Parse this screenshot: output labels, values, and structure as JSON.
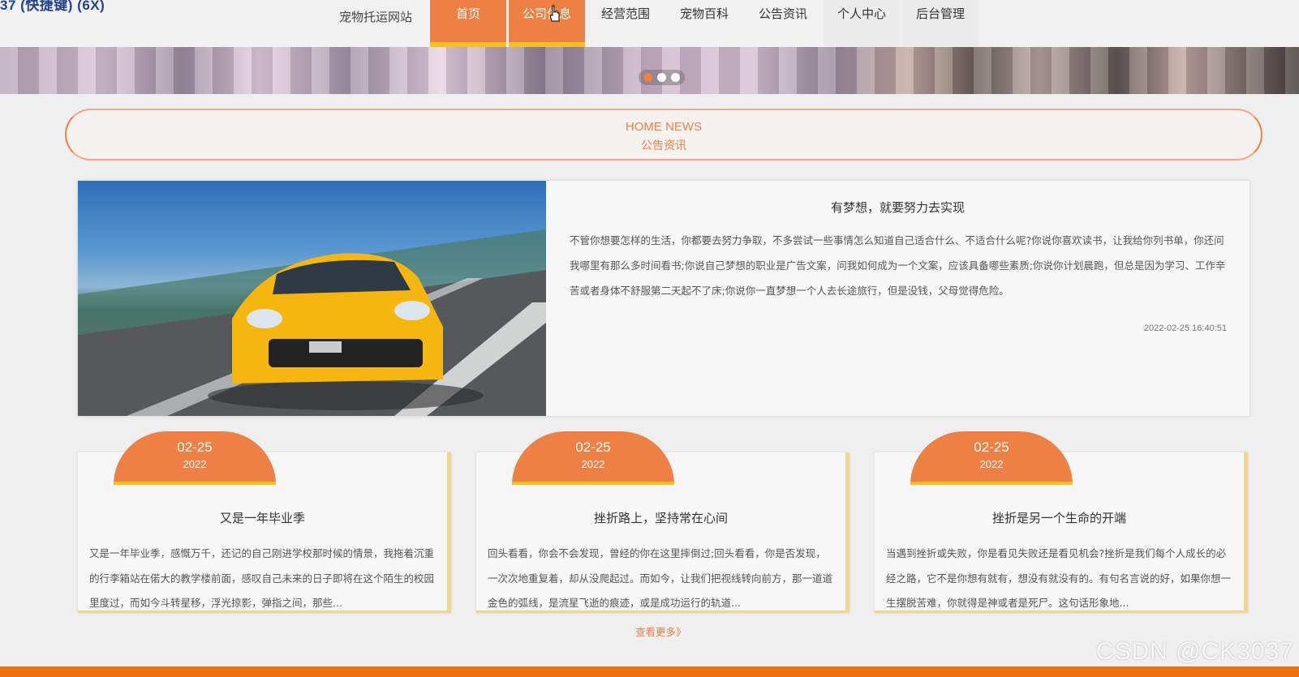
{
  "overlay": {
    "caption": "37 (快捷键) (6X)"
  },
  "header": {
    "site_name": "宠物托运网站",
    "nav": [
      "首页",
      "公司信息",
      "经营范围",
      "宠物百科",
      "公告资讯",
      "个人中心",
      "后台管理"
    ],
    "active_index": 0
  },
  "carousel": {
    "dot_count": 3,
    "active_dot": 0
  },
  "section": {
    "title_en": "HOME NEWS",
    "title_cn": "公告资讯"
  },
  "featured": {
    "title": "有梦想，就要努力去实现",
    "text": "不管你想要怎样的生活，你都要去努力争取，不多尝试一些事情怎么知道自己适合什么、不适合什么呢?你说你喜欢读书，让我给你列书单，你还问我哪里有那么多时间看书;你说自己梦想的职业是广告文案，问我如何成为一个文案，应该具备哪些素质;你说你计划晨跑，但总是因为学习、工作辛苦或者身体不舒服第二天起不了床;你说你一直梦想一个人去长途旅行，但是没钱，父母觉得危险。",
    "time": "2022-02-25 16:40:51"
  },
  "cards": [
    {
      "md": "02-25",
      "year": "2022",
      "title": "又是一年毕业季",
      "text": "又是一年毕业季，感慨万千，还记的自己刚进学校那时候的情景，我拖着沉重的行李箱站在偌大的教学楼前面，感叹自己未来的日子即将在这个陌生的校园里度过，而如今斗转星移，浮光掠影，弹指之间，那些..."
    },
    {
      "md": "02-25",
      "year": "2022",
      "title": "挫折路上，坚持常在心间",
      "text": "回头看看，你会不会发现，曾经的你在这里摔倒过;回头看看，你是否发现，一次次地重复着，却从没爬起过。而如今，让我们把视线转向前方，那一道道金色的弧线，是流星飞逝的痕迹，或是成功运行的轨道..."
    },
    {
      "md": "02-25",
      "year": "2022",
      "title": "挫折是另一个生命的开端",
      "text": "当遇到挫折或失败，你是看见失败还是看见机会?挫折是我们每个人成长的必经之路，它不是你想有就有，想没有就没有的。有句名言说的好，如果你想一生摆脱苦难，你就得是神或者是死尸。这句话形象地..."
    }
  ],
  "more_label": "查看更多》",
  "watermark": "CSDN @CK3037",
  "colors": {
    "accent": "#ee7f45",
    "accent_bottom": "#f6c022",
    "footer": "#ee6e10"
  }
}
